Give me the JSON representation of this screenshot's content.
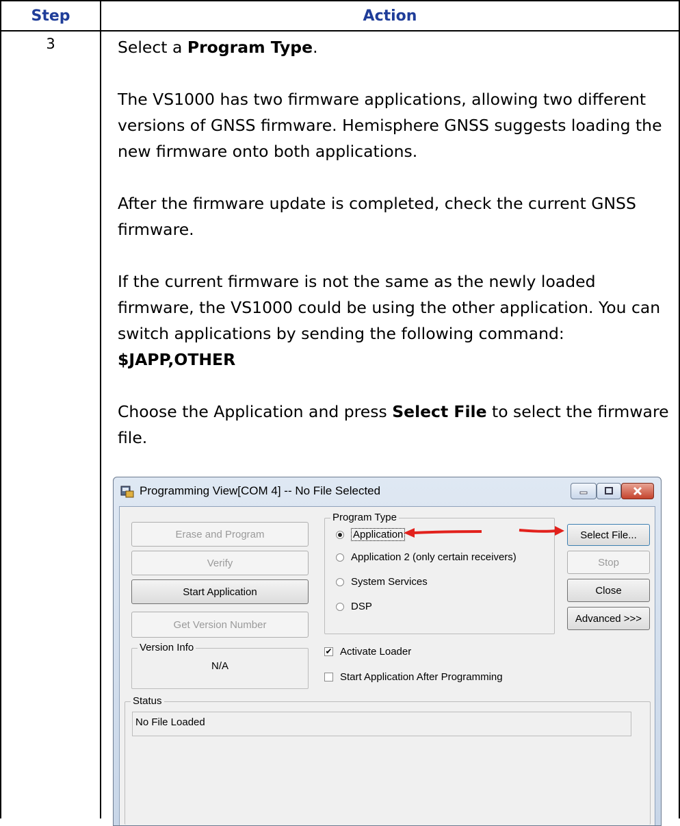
{
  "table": {
    "header_step": "Step",
    "header_action": "Action",
    "step_number": "3"
  },
  "body": {
    "line1_pre": "Select a ",
    "line1_bold": "Program Type",
    "line1_post": ".",
    "para1": "The VS1000 has two firmware applications, allowing two different versions of GNSS firmware. Hemisphere GNSS suggests loading the new firmware onto both applications.",
    "para2": "After the firmware update is completed, check the current GNSS firmware.",
    "para3": "If the current firmware is not the same as the newly loaded firmware, the VS1000 could be using the other application. You can switch applications by sending the following command:",
    "command": "$JAPP,OTHER",
    "para4_pre": "Choose the Application and press ",
    "para4_bold": "Select File",
    "para4_post": " to select the firmware file."
  },
  "window": {
    "title": "Programming View[COM 4] -- No File Selected",
    "buttons": {
      "erase_program": "Erase and Program",
      "verify": "Verify",
      "start_application": "Start Application",
      "get_version": "Get Version Number",
      "select_file": "Select File...",
      "stop": "Stop",
      "close": "Close",
      "advanced": "Advanced >>>"
    },
    "program_type": {
      "label": "Program Type",
      "options": [
        "Application",
        "Application 2 (only certain receivers)",
        "System Services",
        "DSP"
      ],
      "selected": "Application"
    },
    "version_info": {
      "label": "Version Info",
      "value": "N/A"
    },
    "activate_loader": {
      "label": "Activate Loader",
      "checked": true,
      "mark": "✔"
    },
    "start_after": {
      "label": "Start Application After Programming",
      "checked": false
    },
    "status": {
      "label": "Status",
      "value": "No File Loaded"
    },
    "arrow_color": "#e2211c"
  }
}
